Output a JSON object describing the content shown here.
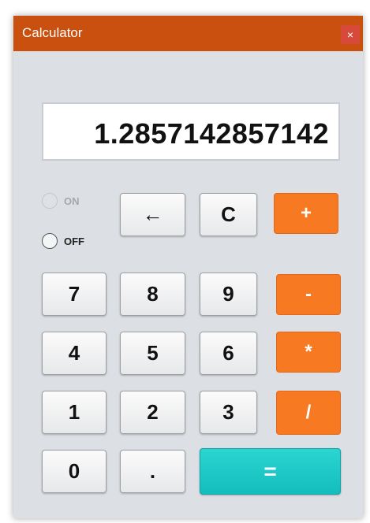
{
  "window": {
    "title": "Calculator",
    "close_label": "×"
  },
  "display": {
    "value": "1.2857142857142"
  },
  "power": {
    "on_label": "ON",
    "off_label": "OFF",
    "on_enabled": false,
    "off_selected": false
  },
  "keys": {
    "backspace": "←",
    "clear": "C",
    "plus": "+",
    "minus": "-",
    "multiply": "*",
    "divide": "/",
    "equals": "=",
    "decimal": ".",
    "d0": "0",
    "d1": "1",
    "d2": "2",
    "d3": "3",
    "d4": "4",
    "d5": "5",
    "d6": "6",
    "d7": "7",
    "d8": "8",
    "d9": "9"
  },
  "colors": {
    "titlebar": "#c9500f",
    "operator": "#f77a22",
    "equals": "#13bdbd",
    "window_bg": "#dcdfe4"
  }
}
